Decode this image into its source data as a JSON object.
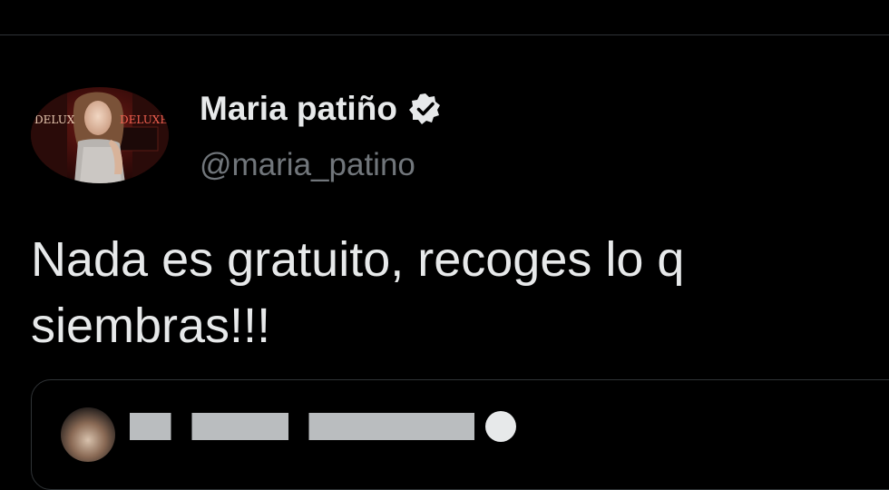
{
  "tweet": {
    "display_name": "Maria patiño",
    "handle": "@maria_patino",
    "text": "Nada es gratuito, recoges lo q siembras!!!",
    "avatar_text": "DELUX",
    "avatar_text_2": "DELUXE"
  },
  "icons": {
    "verified": "verified-badge-icon"
  },
  "colors": {
    "background": "#000000",
    "primary_text": "#e7e9ea",
    "secondary_text": "#71767b",
    "divider": "#2f3336"
  }
}
